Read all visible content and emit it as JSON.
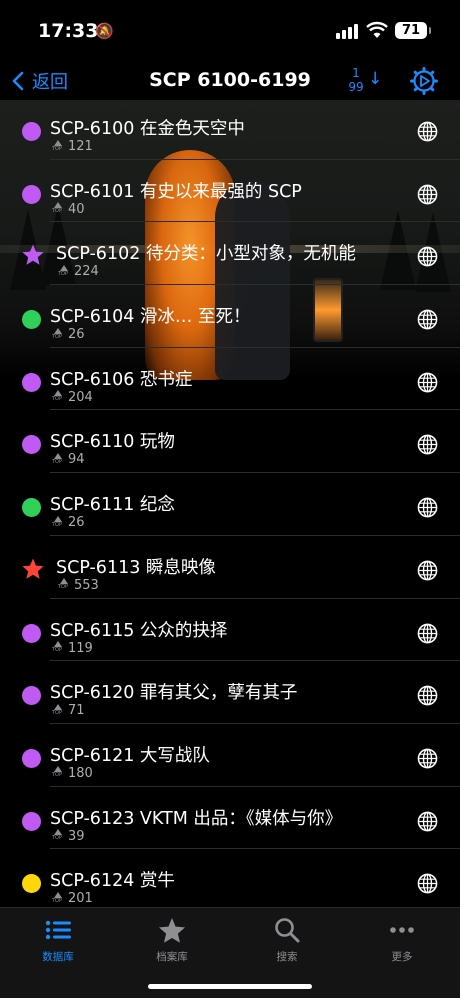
{
  "status_bar": {
    "time": "17:33",
    "battery": "71"
  },
  "nav": {
    "back_label": "返回",
    "title": "SCP 6100-6199",
    "sort_top": "1",
    "sort_bottom": "99"
  },
  "colors": {
    "accent": "#1a8cff",
    "purple": "#bf5af2",
    "green": "#30d158",
    "red": "#ff453a",
    "yellow": "#ffd60a"
  },
  "items": [
    {
      "name": "SCP-6100 在金色天空中",
      "rating": "121",
      "marker": "dot",
      "color": "#bf5af2"
    },
    {
      "name": "SCP-6101 有史以来最强的 SCP",
      "rating": "40",
      "marker": "dot",
      "color": "#bf5af2"
    },
    {
      "name": "SCP-6102 待分类：小型对象，无机能",
      "rating": "224",
      "marker": "star",
      "color": "#bf5af2"
    },
    {
      "name": "SCP-6104 滑冰… 至死！",
      "rating": "26",
      "marker": "dot",
      "color": "#30d158"
    },
    {
      "name": "SCP-6106 恐书症",
      "rating": "204",
      "marker": "dot",
      "color": "#bf5af2"
    },
    {
      "name": "SCP-6110 玩物",
      "rating": "94",
      "marker": "dot",
      "color": "#bf5af2"
    },
    {
      "name": "SCP-6111 纪念",
      "rating": "26",
      "marker": "dot",
      "color": "#30d158"
    },
    {
      "name": "SCP-6113 瞬息映像",
      "rating": "553",
      "marker": "star",
      "color": "#ff453a"
    },
    {
      "name": "SCP-6115 公众的抉择",
      "rating": "119",
      "marker": "dot",
      "color": "#bf5af2"
    },
    {
      "name": "SCP-6120 罪有其父，孽有其子",
      "rating": "71",
      "marker": "dot",
      "color": "#bf5af2"
    },
    {
      "name": "SCP-6121 大写战队",
      "rating": "180",
      "marker": "dot",
      "color": "#bf5af2"
    },
    {
      "name": "SCP-6123 VKTM 出品：《媒体与你》",
      "rating": "39",
      "marker": "dot",
      "color": "#bf5af2"
    },
    {
      "name": "SCP-6124 赏牛",
      "rating": "201",
      "marker": "dot",
      "color": "#ffd60a"
    }
  ],
  "tabs": [
    {
      "label": "数据库",
      "icon": "list-icon",
      "active": true
    },
    {
      "label": "档案库",
      "icon": "star-icon",
      "active": false
    },
    {
      "label": "搜索",
      "icon": "search-icon",
      "active": false
    },
    {
      "label": "更多",
      "icon": "more-icon",
      "active": false
    }
  ]
}
